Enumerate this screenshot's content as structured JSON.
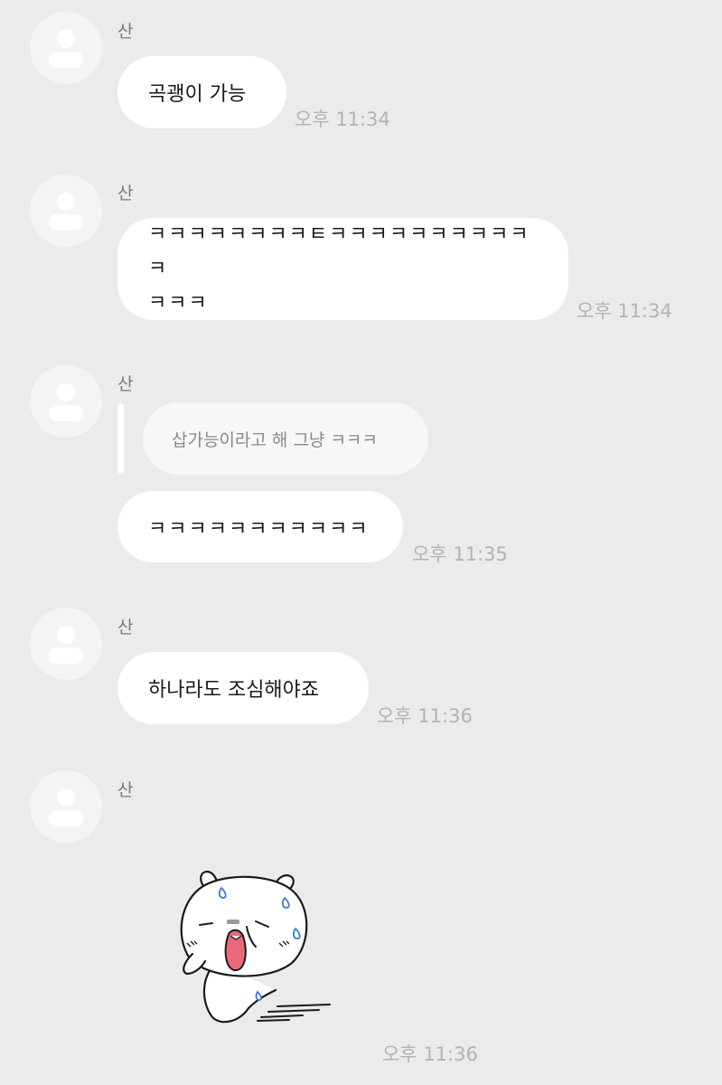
{
  "messages": [
    {
      "sender": "산",
      "text": "곡괭이 가능",
      "time": "오후 11:34"
    },
    {
      "sender": "산",
      "text_line1": "ㅋㅋㅋㅋㅋㅋㅋㅋㅌㅋㅋㅋㅋㅋㅋㅋㅋㅋㅋㅋ",
      "text_line2": "ㅋㅋㅋ",
      "time": "오후 11:34"
    },
    {
      "sender": "산",
      "quoted_text": "삽가능이라고 해 그냥 ㅋㅋㅋ",
      "text": "ㅋㅋㅋㅋㅋㅋㅋㅋㅋㅋㅋ",
      "time": "오후 11:35"
    },
    {
      "sender": "산",
      "text": "하나라도 조심해야죠",
      "time": "오후 11:36"
    },
    {
      "sender": "산",
      "sticker": "sweating-white-bear-sticker",
      "time": "오후 11:36"
    }
  ],
  "colors": {
    "background": "#ebebeb",
    "bubble": "#ffffff",
    "quote_bubble": "#f7f7f7",
    "time_text": "#b3b3b3",
    "sender_text": "#7a7a7a"
  }
}
